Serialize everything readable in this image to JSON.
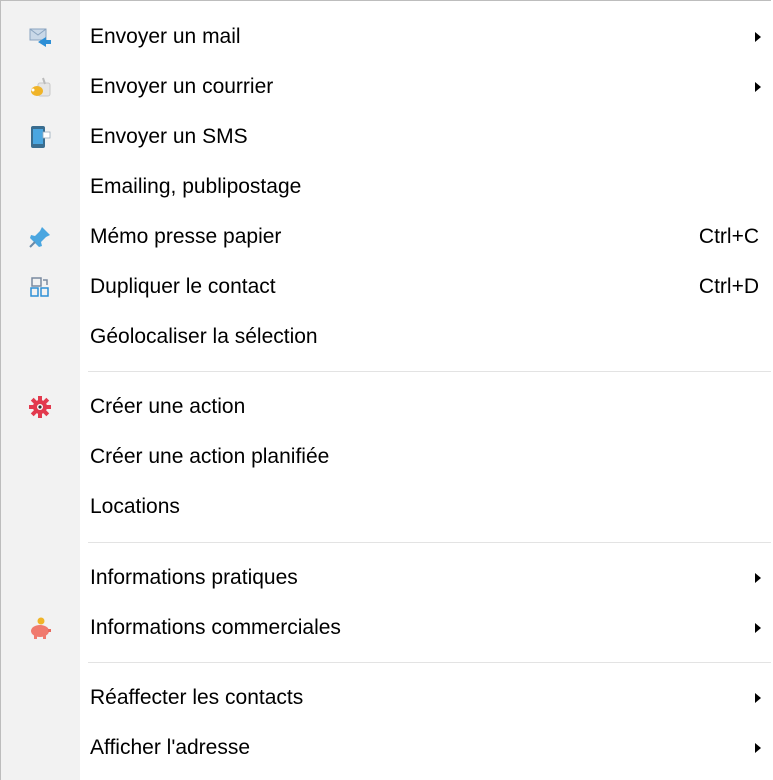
{
  "menu": {
    "items": [
      {
        "label": "Envoyer un mail",
        "icon": "mail-send-icon",
        "submenu": true
      },
      {
        "label": "Envoyer un courrier",
        "icon": "letter-send-icon",
        "submenu": true
      },
      {
        "label": "Envoyer un SMS",
        "icon": "phone-sms-icon"
      },
      {
        "label": "Emailing, publipostage"
      },
      {
        "label": "Mémo presse papier",
        "icon": "pin-icon",
        "shortcut": "Ctrl+C"
      },
      {
        "label": "Dupliquer le contact",
        "icon": "duplicate-icon",
        "shortcut": "Ctrl+D"
      },
      {
        "label": "Géolocaliser la sélection"
      },
      {
        "label": "Créer une action",
        "icon": "gear-icon"
      },
      {
        "label": "Créer une action planifiée"
      },
      {
        "label": "Locations"
      },
      {
        "label": "Informations pratiques",
        "submenu": true
      },
      {
        "label": "Informations commerciales",
        "icon": "piggy-bank-icon",
        "submenu": true
      },
      {
        "label": "Réaffecter les contacts",
        "submenu": true
      },
      {
        "label": "Afficher l'adresse",
        "submenu": true
      }
    ]
  },
  "colors": {
    "gutter": "#f2f2f2",
    "separator": "#e3e3e3",
    "gear_red": "#e23a4e",
    "mail_blue": "#2d8fd6",
    "piggy_pink": "#f07a6e",
    "letter_yellow": "#f0b428"
  }
}
